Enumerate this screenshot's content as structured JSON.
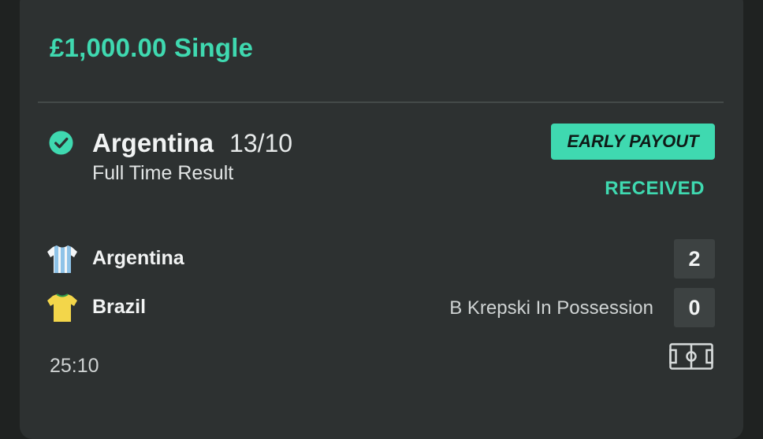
{
  "bet": {
    "title": "£1,000.00 Single"
  },
  "selection": {
    "name": "Argentina",
    "odds": "13/10",
    "market": "Full Time Result",
    "status_icon": "check-circle-icon"
  },
  "offer": {
    "badge_label": "EARLY PAYOUT",
    "status_label": "RECEIVED"
  },
  "match": {
    "home": {
      "name": "Argentina",
      "score": "2",
      "shirt_icon": "argentina-shirt-icon"
    },
    "away": {
      "name": "Brazil",
      "score": "0",
      "shirt_icon": "brazil-shirt-icon"
    },
    "live_status": "B Krepski In Possession",
    "clock": "25:10",
    "pitch_icon": "pitch-icon"
  },
  "colors": {
    "accent": "#3fd9b0",
    "card_background": "#2d3131",
    "page_background": "#1f2221",
    "score_box": "#3d4242"
  }
}
